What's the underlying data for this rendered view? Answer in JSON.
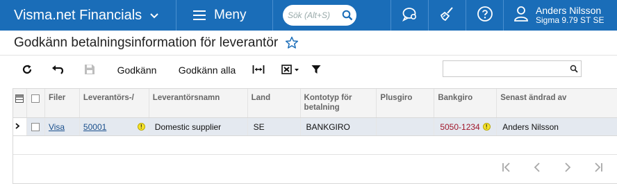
{
  "app": {
    "title": "Visma.net Financials",
    "menu_label": "Meny",
    "search_placeholder": "Sök (Alt+S)",
    "user_name": "Anders Nilsson",
    "user_context": "Sigma 9.79 ST SE",
    "icons": [
      "chevron-down-icon",
      "hamburger-icon",
      "search-icon",
      "chat-icon",
      "broom-icon",
      "help-icon",
      "user-icon"
    ]
  },
  "page": {
    "title": "Godkänn betalningsinformation för leverantör",
    "favorite_icon": "star-icon"
  },
  "toolbar": {
    "approve_label": "Godkänn",
    "approve_all_label": "Godkänn alla",
    "search_value": "",
    "icons": [
      "refresh-icon",
      "undo-icon",
      "save-icon",
      "fit-columns-icon",
      "export-excel-icon",
      "filter-icon"
    ]
  },
  "grid": {
    "headers": {
      "files": "Filer",
      "supplier": "Leverantörs-/",
      "supplier_name": "Leverantörsnamn",
      "country": "Land",
      "account_type": "Kontotyp för betalning",
      "plusgiro": "Plusgiro",
      "bankgiro": "Bankgiro",
      "changed_by": "Senast ändrad av"
    },
    "rows": [
      {
        "files": "Visa",
        "supplier": "50001",
        "supplier_name": "Domestic supplier",
        "country": "SE",
        "account_type": "BANKGIRO",
        "plusgiro": "",
        "bankgiro": "5050-1234",
        "changed_by": "Anders Nilsson"
      }
    ]
  },
  "colors": {
    "topbar": "#1a6db8",
    "selected_row": "#e4e9f0",
    "link": "#1a4f8c",
    "bankgiro_text": "#a0162a",
    "warning": "#f5e22a"
  }
}
